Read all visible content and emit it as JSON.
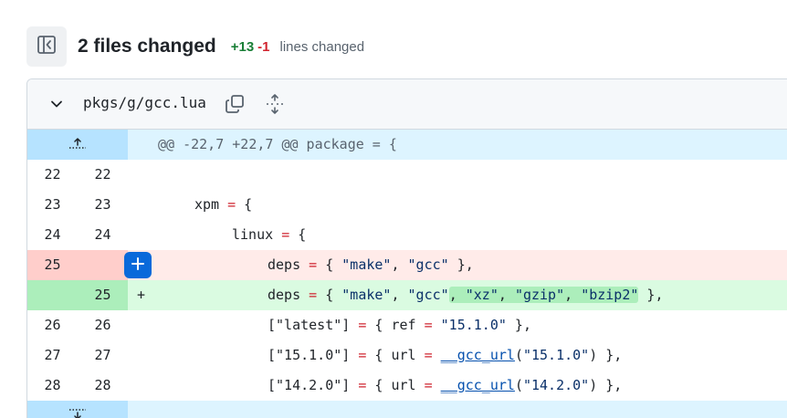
{
  "summary": {
    "title": "2 files changed",
    "additions": "+13",
    "deletions": "-1",
    "lines_label": "lines changed"
  },
  "file": {
    "name": "pkgs/g/gcc.lua",
    "hunk_header": "@@ -22,7 +22,7 @@ package = {",
    "rows": [
      {
        "old": "22",
        "new": "22"
      },
      {
        "old": "23",
        "new": "23"
      },
      {
        "old": "24",
        "new": "24"
      },
      {
        "old": "25",
        "new": ""
      },
      {
        "old": "",
        "new": "25",
        "marker": "+"
      },
      {
        "old": "26",
        "new": "26"
      },
      {
        "old": "27",
        "new": "27"
      },
      {
        "old": "28",
        "new": "28"
      }
    ],
    "code": {
      "xpm": "xpm",
      "linux": "linux",
      "deps": "deps",
      "eq": "=",
      "lbrace": " {",
      "space": " ",
      "make": "\"make\"",
      "gcc": "\"gcc\"",
      "xz": "\"xz\"",
      "gzip": "\"gzip\"",
      "bzip2": "\"bzip2\"",
      "comma": ", ",
      "open": "{ ",
      "close": " },",
      "latest_key": "[\"latest\"]",
      "v1510_key": "[\"15.1.0\"]",
      "v1420_key": "[\"14.2.0\"]",
      "ref": "ref",
      "url": "url",
      "fn": "__gcc_url",
      "v1510": "\"15.1.0\"",
      "v1420": "\"14.2.0\"",
      "lparen": "(",
      "rparen_close": ") },"
    }
  },
  "colors": {
    "addition": "#1a7f37",
    "deletion": "#d1242f",
    "hunk_bg": "#ddf4ff",
    "add_bg": "#dafbe1",
    "del_bg": "#ffebe9",
    "accent": "#0969da"
  },
  "icons": [
    "sidebar-toggle-icon",
    "chevron-down-icon",
    "copy-icon",
    "unfold-icon",
    "expand-up-icon",
    "expand-down-icon",
    "plus-icon"
  ]
}
